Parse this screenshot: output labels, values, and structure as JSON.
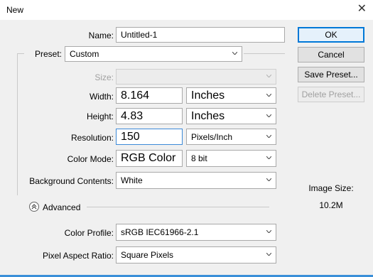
{
  "window": {
    "title": "New",
    "close_icon": "close-icon"
  },
  "buttons": {
    "ok": "OK",
    "cancel": "Cancel",
    "save_preset": "Save Preset...",
    "delete_preset": "Delete Preset..."
  },
  "form": {
    "name": {
      "label": "Name:",
      "value": "Untitled-1"
    },
    "preset": {
      "label": "Preset:",
      "value": "Custom"
    },
    "size": {
      "label": "Size:",
      "value": ""
    },
    "width": {
      "label": "Width:",
      "value": "8.164",
      "unit": "Inches"
    },
    "height": {
      "label": "Height:",
      "value": "4.83",
      "unit": "Inches"
    },
    "resolution": {
      "label": "Resolution:",
      "value": "150",
      "unit": "Pixels/Inch"
    },
    "color_mode": {
      "label": "Color Mode:",
      "value": "RGB Color",
      "depth": "8 bit"
    },
    "background": {
      "label": "Background Contents:",
      "value": "White"
    },
    "advanced": {
      "label": "Advanced"
    },
    "color_profile": {
      "label": "Color Profile:",
      "value": "sRGB IEC61966-2.1"
    },
    "pixel_aspect": {
      "label": "Pixel Aspect Ratio:",
      "value": "Square Pixels"
    }
  },
  "image_size": {
    "label": "Image Size:",
    "value": "10.2M"
  },
  "colors": {
    "accent": "#0078d7",
    "focus": "#3d8ad8"
  }
}
